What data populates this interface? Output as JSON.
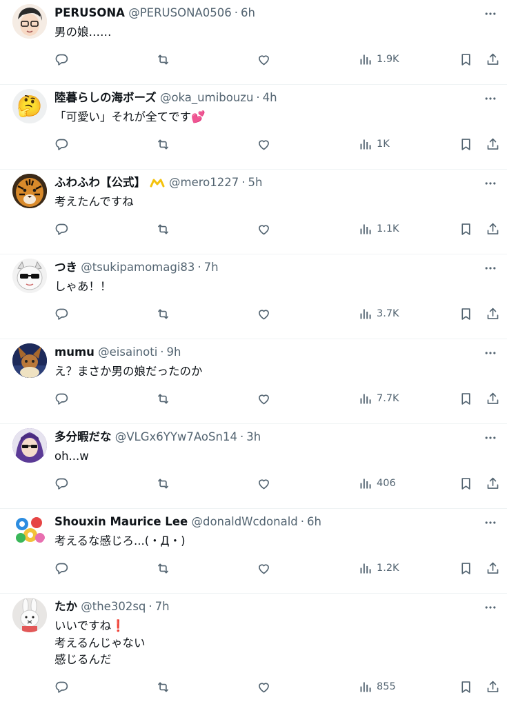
{
  "tweets": [
    {
      "name": "PERUSONA",
      "handle": "@PERUSONA0506",
      "time": "6h",
      "text": "男の娘……",
      "views": "1.9K",
      "avatar": "glasses",
      "badge": false
    },
    {
      "name": "陸暮らしの海ボーズ",
      "handle": "@oka_umibouzu",
      "time": "4h",
      "text": "「可愛い」それが全てです💕",
      "views": "1K",
      "avatar": "thinking",
      "badge": false
    },
    {
      "name": "ふわふわ【公式】",
      "handle": "@mero1227",
      "time": "5h",
      "text": "考えたんですね",
      "views": "1.1K",
      "avatar": "tiger",
      "badge": true
    },
    {
      "name": "つき",
      "handle": "@tsukipamomagi83",
      "time": "7h",
      "text": "しゃあ！！",
      "views": "3.7K",
      "avatar": "shades",
      "badge": false
    },
    {
      "name": "mumu",
      "handle": "@eisainoti",
      "time": "9h",
      "text": "え？まさか男の娘だったのか",
      "views": "7.7K",
      "avatar": "eevee",
      "badge": false
    },
    {
      "name": "多分暇だな",
      "handle": "@VLGx6YYw7AoSn14",
      "time": "3h",
      "text": "oh...w",
      "views": "406",
      "avatar": "purple",
      "badge": false
    },
    {
      "name": "Shouxin Maurice Lee",
      "handle": "@donaldWcdonald",
      "time": "6h",
      "text": "考えるな感じろ...(・Д・)",
      "views": "1.2K",
      "avatar": "colorful",
      "badge": false
    },
    {
      "name": "たか",
      "handle": "@the302sq",
      "time": "7h",
      "text": "いいですね❗\n考えるんじゃない\n感じるんだ",
      "views": "855",
      "avatar": "bunny",
      "badge": false
    }
  ],
  "icons": {
    "reply": "reply-icon",
    "retweet": "retweet-icon",
    "like": "heart-icon",
    "views": "views-icon",
    "bookmark": "bookmark-icon",
    "share": "share-icon",
    "more": "more-icon"
  },
  "colors": {
    "text": "#0f1419",
    "secondary": "#536471",
    "divider": "#eff3f4",
    "badge": "#f4c20d"
  }
}
